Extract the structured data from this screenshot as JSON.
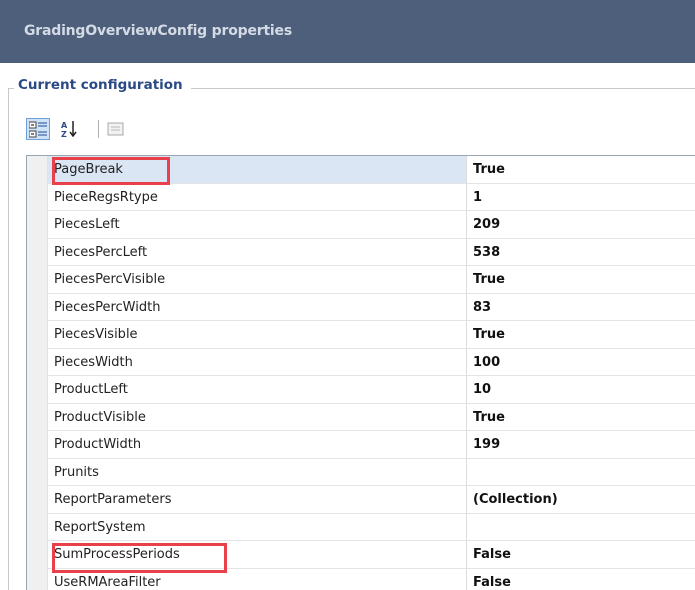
{
  "window": {
    "title": "GradingOverviewConfig properties"
  },
  "group": {
    "legend": "Current configuration"
  },
  "toolbar": {
    "buttons": [
      {
        "icon": "categorized-icon",
        "active": true
      },
      {
        "icon": "sort-alphabetical-icon",
        "active": false
      },
      {
        "icon": "property-pages-icon",
        "active": false
      }
    ]
  },
  "properties": [
    {
      "name": "PageBreak",
      "value": "True"
    },
    {
      "name": "PieceRegsRtype",
      "value": "1"
    },
    {
      "name": "PiecesLeft",
      "value": "209"
    },
    {
      "name": "PiecesPercLeft",
      "value": "538"
    },
    {
      "name": "PiecesPercVisible",
      "value": "True"
    },
    {
      "name": "PiecesPercWidth",
      "value": "83"
    },
    {
      "name": "PiecesVisible",
      "value": "True"
    },
    {
      "name": "PiecesWidth",
      "value": "100"
    },
    {
      "name": "ProductLeft",
      "value": "10"
    },
    {
      "name": "ProductVisible",
      "value": "True"
    },
    {
      "name": "ProductWidth",
      "value": "199"
    },
    {
      "name": "Prunits",
      "value": ""
    },
    {
      "name": "ReportParameters",
      "value": "(Collection)"
    },
    {
      "name": "ReportSystem",
      "value": ""
    },
    {
      "name": "SumProcessPeriods",
      "value": "False"
    },
    {
      "name": "UseRMAreaFilter",
      "value": "False"
    }
  ],
  "colors": {
    "titlebar": "#4d5f7a",
    "legend": "#2a4a86",
    "highlight": "#e8414b",
    "selected_row": "#dbe6f4"
  }
}
